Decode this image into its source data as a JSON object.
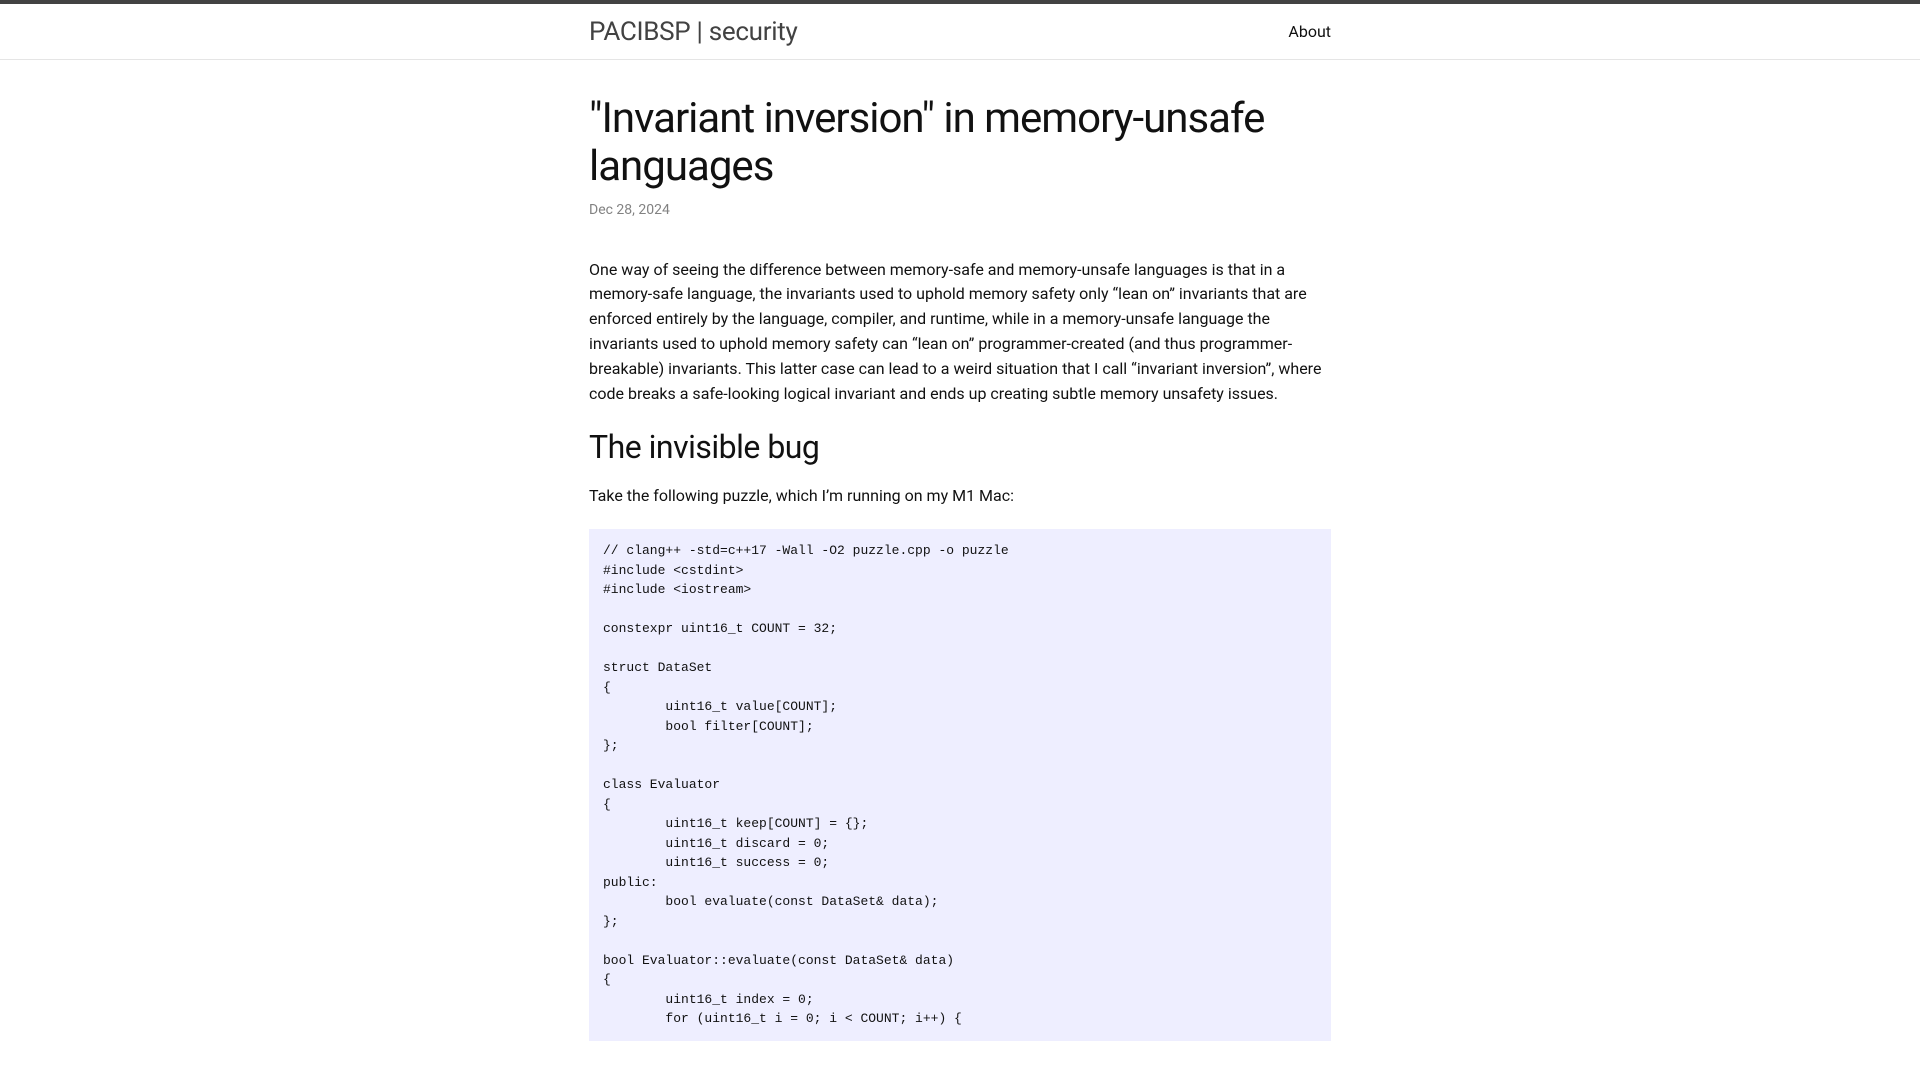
{
  "header": {
    "site_title": "PACIBSP | security",
    "nav_about": "About"
  },
  "post": {
    "title": "\"Invariant inversion\" in memory-unsafe languages",
    "date": "Dec 28, 2024",
    "intro_paragraph": "One way of seeing the difference between memory-safe and memory-unsafe languages is that in a memory-safe language, the invariants used to uphold memory safety only “lean on” invariants that are enforced entirely by the language, compiler, and runtime, while in a memory-unsafe language the invariants used to uphold memory safety can “lean on” programmer-created (and thus programmer-breakable) invariants. This latter case can lead to a weird situation that I call “invariant inversion”, where code breaks a safe-looking logical invariant and ends up creating subtle memory unsafety issues.",
    "section_heading": "The invisible bug",
    "section_intro": "Take the following puzzle, which I’m running on my M1 Mac:",
    "code": "// clang++ -std=c++17 -Wall -O2 puzzle.cpp -o puzzle\n#include <cstdint>\n#include <iostream>\n\nconstexpr uint16_t COUNT = 32;\n\nstruct DataSet\n{\n        uint16_t value[COUNT];\n        bool filter[COUNT];\n};\n\nclass Evaluator\n{\n        uint16_t keep[COUNT] = {};\n        uint16_t discard = 0;\n        uint16_t success = 0;\npublic:\n        bool evaluate(const DataSet& data);\n};\n\nbool Evaluator::evaluate(const DataSet& data)\n{\n        uint16_t index = 0;\n        for (uint16_t i = 0; i < COUNT; i++) {"
  }
}
